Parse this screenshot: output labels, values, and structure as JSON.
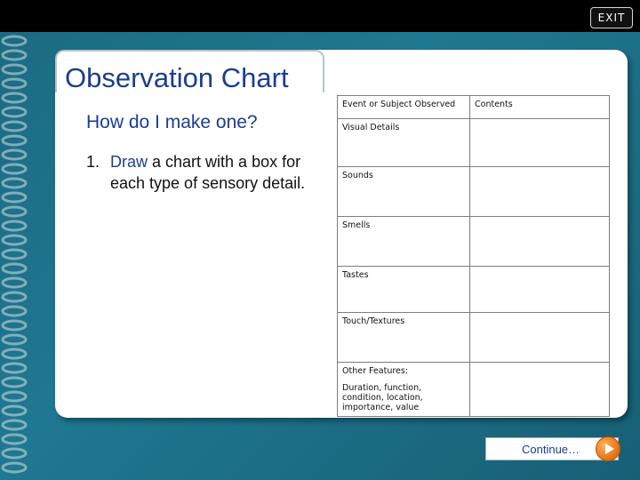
{
  "header": {
    "exit_label": "EXIT"
  },
  "slide": {
    "title": "Observation Chart",
    "subtitle": "How do I make one?",
    "step": {
      "number": "1.",
      "keyword": "Draw",
      "rest": " a chart with a box for each type of sensory detail."
    }
  },
  "table": {
    "headers": [
      "Event or Subject Observed",
      "Contents"
    ],
    "rows": [
      {
        "label": "Visual Details",
        "content": ""
      },
      {
        "label": "Sounds",
        "content": ""
      },
      {
        "label": "Smells",
        "content": ""
      },
      {
        "label": "Tastes",
        "content": ""
      },
      {
        "label": "Touch/Textures",
        "content": ""
      },
      {
        "label": "Other Features:",
        "detail": "Duration, function, condition, location, importance, value",
        "content": ""
      }
    ]
  },
  "footer": {
    "continue_label": "Continue…"
  },
  "colors": {
    "accent": "#1a3d8f",
    "background": "#1f7891",
    "button_orange": "#e56e10"
  }
}
